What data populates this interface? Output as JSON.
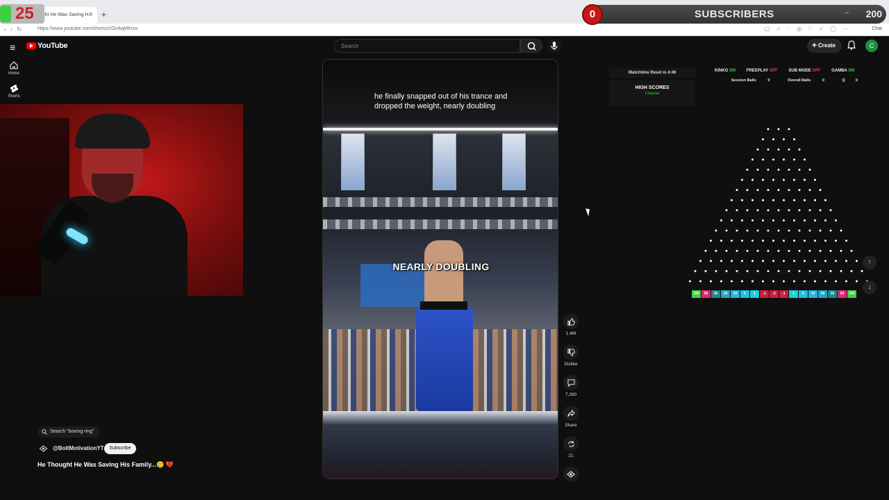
{
  "browser": {
    "tab_title": "He Thought He Was Saving H...",
    "url": "https://www.youtube.com/shorts/z/GnAqMKrzo",
    "chat_label": "Chat"
  },
  "overlay": {
    "counter": "25",
    "subscribers_count": "0",
    "subscribers_label": "SUBSCRIBERS",
    "subscribers_goal": "200",
    "separator": "–"
  },
  "youtube": {
    "logo_text": "YouTube",
    "search_placeholder": "Search",
    "create_label": "Create",
    "avatar_letter": "C",
    "sidebar": [
      {
        "label": "Home"
      },
      {
        "label": "Shorts"
      }
    ],
    "short": {
      "caption": "he finally snapped out of his trance and dropped the weight, nearly doubling",
      "overlay_text": "NEARLY DOUBLING",
      "search_chip": "Search \"boxing ring\"",
      "channel": "@BoltMotivationYT",
      "subscribe_label": "Subscribe",
      "title": "He Thought He Was Saving His Family...🥲 💔"
    },
    "actions": [
      {
        "icon": "like-icon",
        "label": "1.4M"
      },
      {
        "icon": "dislike-icon",
        "label": "Dislike"
      },
      {
        "icon": "comment-icon",
        "label": "7,280"
      },
      {
        "icon": "share-icon",
        "label": "Share"
      },
      {
        "icon": "remix-icon",
        "label": "21"
      },
      {
        "icon": "channel-icon",
        "label": ""
      }
    ]
  },
  "game": {
    "watchtime": "Watchtime Reset in 4:46",
    "high_scores_title": "HIGH SCORES",
    "high_scores_sub": "Channel",
    "flags": [
      {
        "name": "KINKO",
        "state": "ON"
      },
      {
        "name": "FREEPLAY",
        "state": "OFF"
      },
      {
        "name": "SUB MODE",
        "state": "OFF"
      },
      {
        "name": "GAMBA",
        "state": "ON"
      }
    ],
    "stats": [
      {
        "label": "Session Balls",
        "value": "0"
      },
      {
        "label": "Overall Balls",
        "value": "0"
      },
      {
        "label": "Q",
        "value": "0"
      }
    ],
    "buckets": [
      {
        "v": "100",
        "c": "#3fd13f"
      },
      {
        "v": "50",
        "c": "#e0267a"
      },
      {
        "v": "35",
        "c": "#1a8a8a"
      },
      {
        "v": "20",
        "c": "#22a8c8"
      },
      {
        "v": "10",
        "c": "#22b8d8"
      },
      {
        "v": "5",
        "c": "#22c0e0"
      },
      {
        "v": "1",
        "c": "#1ad0d8"
      },
      {
        "v": "-1",
        "c": "#c8203a"
      },
      {
        "v": "-2",
        "c": "#c8203a"
      },
      {
        "v": "-1",
        "c": "#c8203a"
      },
      {
        "v": "1",
        "c": "#1ad0d8"
      },
      {
        "v": "5",
        "c": "#22c0e0"
      },
      {
        "v": "10",
        "c": "#22b8d8"
      },
      {
        "v": "20",
        "c": "#22a8c8"
      },
      {
        "v": "35",
        "c": "#1a8a8a"
      },
      {
        "v": "50",
        "c": "#e0267a"
      },
      {
        "v": "100",
        "c": "#3fd13f"
      }
    ]
  }
}
